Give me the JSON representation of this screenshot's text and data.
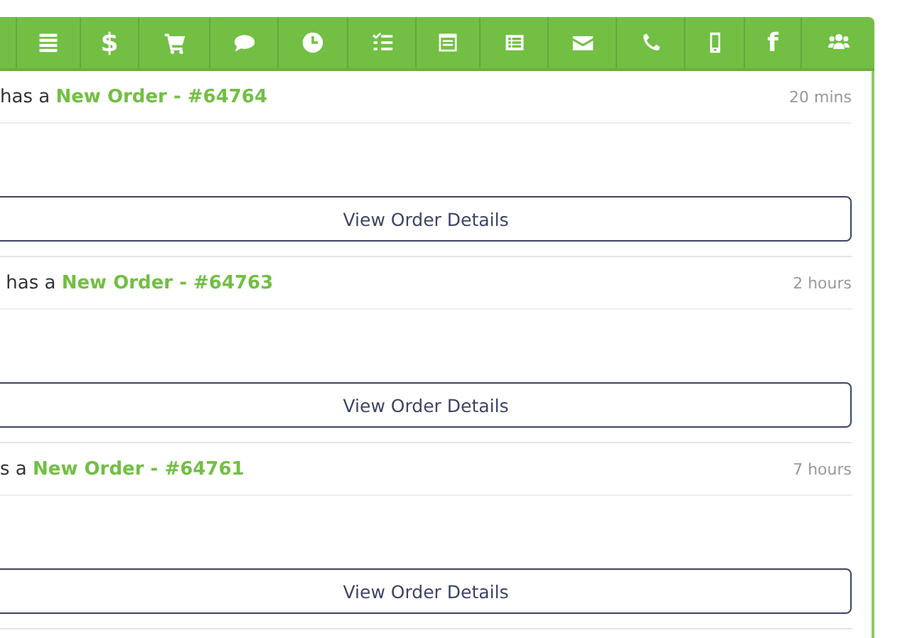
{
  "toolbar": [
    {
      "kind": "partial"
    },
    {
      "kind": "menu"
    },
    {
      "kind": "glyph",
      "glyph": "$"
    },
    {
      "kind": "cart"
    },
    {
      "kind": "chat"
    },
    {
      "kind": "clock"
    },
    {
      "kind": "checklist"
    },
    {
      "kind": "calendar"
    },
    {
      "kind": "list"
    },
    {
      "kind": "envelope"
    },
    {
      "kind": "phone"
    },
    {
      "kind": "mobile"
    },
    {
      "kind": "glyph",
      "glyph": "f"
    },
    {
      "kind": "users"
    }
  ],
  "orders": [
    {
      "prefix": "has a ",
      "link": "New Order - #64764",
      "time": "20 mins",
      "button": "View Order Details"
    },
    {
      "prefix": " has a ",
      "link": "New Order - #64763",
      "time": "2 hours",
      "button": "View Order Details"
    },
    {
      "prefix": "s a ",
      "link": "New Order - #64761",
      "time": "7 hours",
      "button": "View Order Details"
    }
  ]
}
